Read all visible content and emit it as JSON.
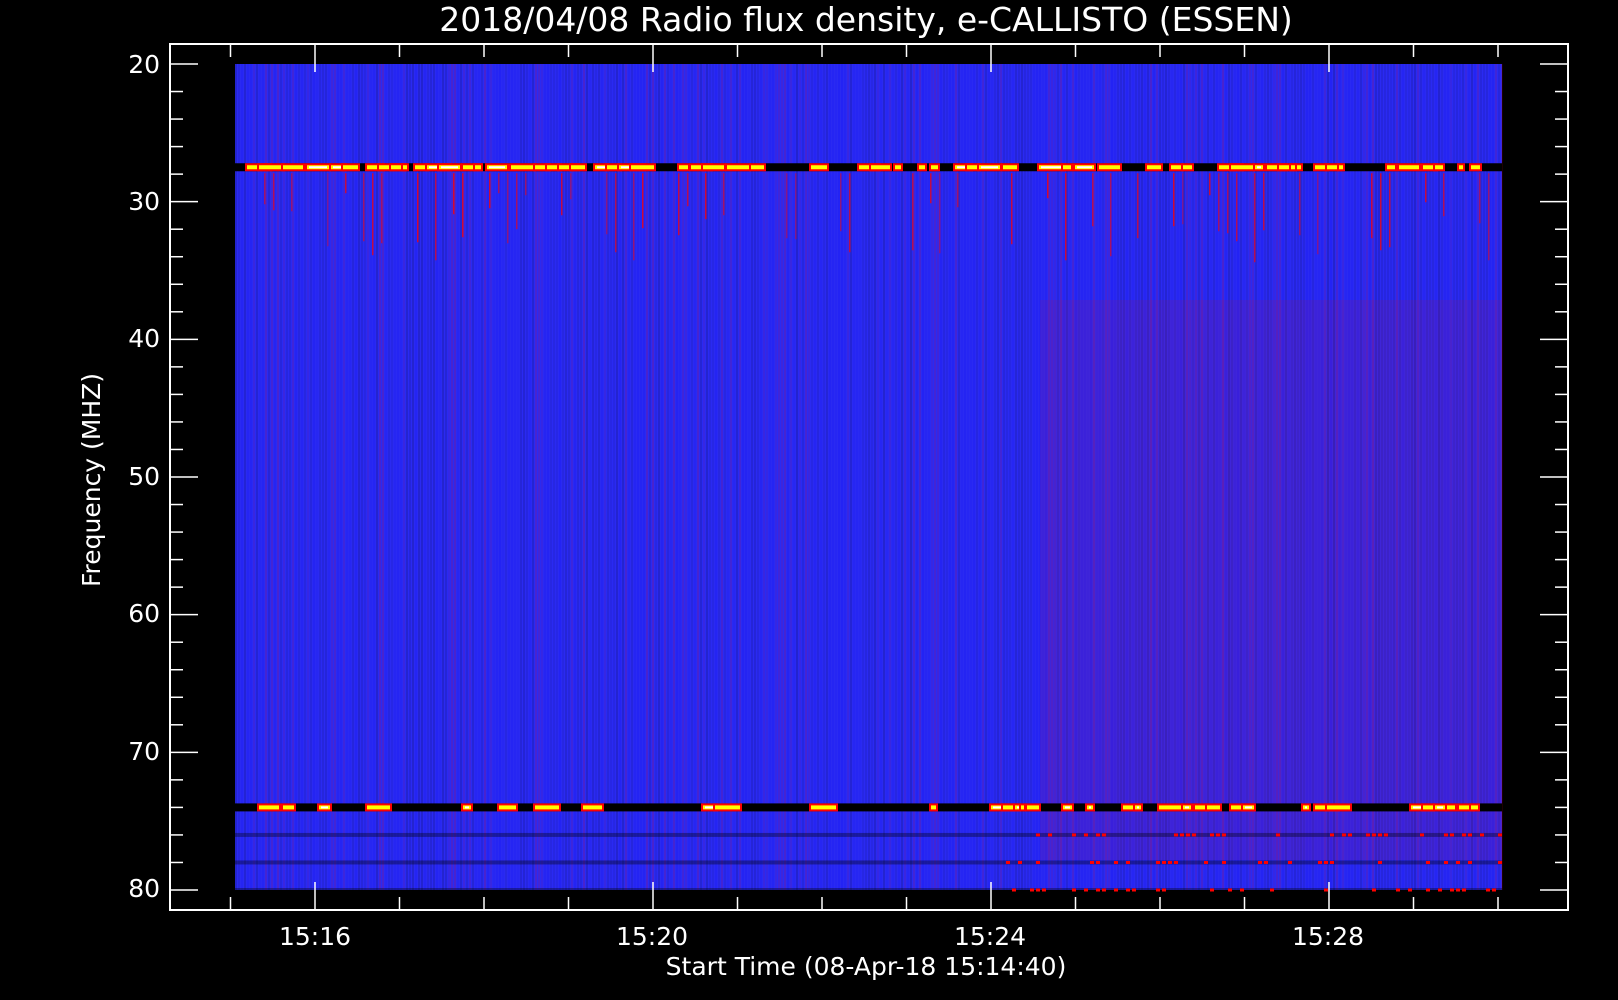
{
  "chart_data": {
    "type": "heatmap",
    "title": "2018/04/08  Radio flux density, e-CALLISTO (ESSEN)",
    "xlabel": "Start Time (08-Apr-18 15:14:40)",
    "ylabel": "Frequency (MHZ)",
    "ylim": [
      80,
      20
    ],
    "x_tick_labels": [
      "15:16",
      "15:20",
      "15:24",
      "15:28"
    ],
    "y_tick_labels": [
      "20",
      "30",
      "40",
      "50",
      "60",
      "70",
      "80"
    ],
    "y_ticks": [
      20,
      30,
      40,
      50,
      60,
      70,
      80
    ],
    "colormap": [
      "#000000",
      "#0000ff",
      "#ff0000",
      "#ffff00",
      "#ffffff"
    ],
    "background_color": "#2a2af2",
    "features": {
      "bursts_MHz": [
        27.5,
        74
      ],
      "bands_MHz": [
        76,
        78,
        80
      ]
    }
  }
}
